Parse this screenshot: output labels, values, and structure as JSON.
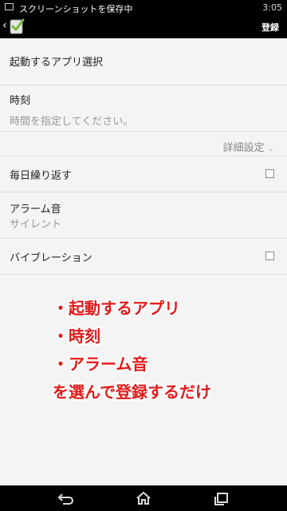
{
  "status_bar": {
    "title": "スクリーンショットを保存中",
    "time": "3:05"
  },
  "action_bar": {
    "register": "登録"
  },
  "form": {
    "app_select_label": "起動するアプリ選択",
    "time_label": "時刻",
    "time_placeholder": "時間を指定してください。",
    "advanced_label": "詳細設定",
    "repeat_label": "毎日繰り返す",
    "alarm_label": "アラーム音",
    "alarm_value": "サイレント",
    "vibration_label": "バイブレーション"
  },
  "annotation": {
    "lines": [
      "・起動するアプリ",
      "・時刻",
      "・アラーム音",
      "を選んで登録するだけ"
    ]
  }
}
